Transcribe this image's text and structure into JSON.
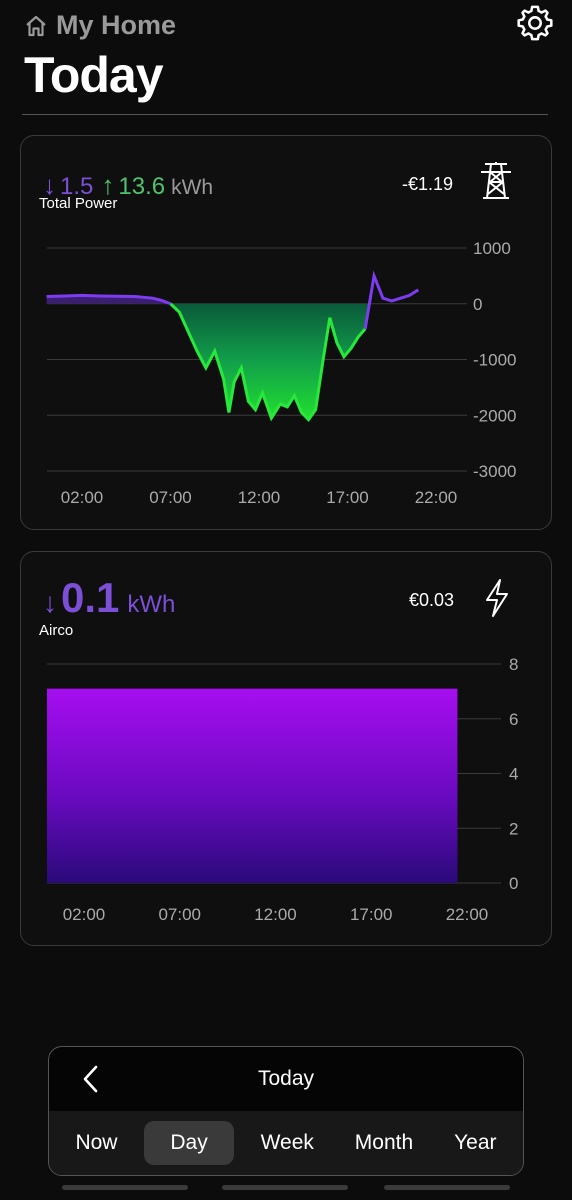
{
  "header": {
    "home_label": "My Home",
    "title": "Today"
  },
  "power_card": {
    "down_arrow": "↓",
    "down_value": "1.5",
    "up_arrow": "↑",
    "up_value": "13.6",
    "unit": "kWh",
    "label": "Total Power",
    "cost": "-€1.19",
    "icon": "power-pylon-icon"
  },
  "airco_card": {
    "down_arrow": "↓",
    "value": "0.1",
    "unit": "kWh",
    "label": "Airco",
    "cost": "€0.03",
    "icon": "lightning-icon"
  },
  "nav": {
    "title": "Today",
    "tabs": [
      {
        "label": "Now",
        "active": false
      },
      {
        "label": "Day",
        "active": true
      },
      {
        "label": "Week",
        "active": false
      },
      {
        "label": "Month",
        "active": false
      },
      {
        "label": "Year",
        "active": false
      }
    ]
  },
  "colors": {
    "purple": "#7b4fd6",
    "green": "#4fc36c",
    "bar": "#a010e8",
    "line_green": "#28e83a"
  },
  "chart_data": [
    {
      "type": "area",
      "x_ticks": [
        "02:00",
        "07:00",
        "12:00",
        "17:00",
        "22:00"
      ],
      "y_ticks": [
        1000,
        0,
        -1000,
        -2000,
        -3000
      ],
      "ylim": [
        -3000,
        1000
      ],
      "x_unit": "hour",
      "x": [
        0,
        1,
        2,
        3,
        4,
        5,
        6,
        6.5,
        7,
        7.5,
        8,
        8.5,
        9,
        9.5,
        10,
        10.3,
        10.6,
        11,
        11.4,
        11.8,
        12.2,
        12.7,
        13.2,
        13.6,
        14,
        14.4,
        14.8,
        15.2,
        15.6,
        16,
        16.4,
        16.8,
        17.2,
        17.6,
        18,
        18.5,
        19,
        19.5,
        20,
        20.5,
        21
      ],
      "values": [
        130,
        140,
        150,
        140,
        135,
        130,
        100,
        60,
        0,
        -150,
        -500,
        -850,
        -1150,
        -850,
        -1350,
        -1950,
        -1400,
        -1150,
        -1750,
        -1900,
        -1600,
        -2050,
        -1800,
        -1850,
        -1650,
        -1950,
        -2080,
        -1900,
        -1050,
        -250,
        -700,
        -950,
        -800,
        -600,
        -450,
        500,
        100,
        50,
        100,
        150,
        250
      ],
      "grid": true
    },
    {
      "type": "bar",
      "x_ticks": [
        "02:00",
        "07:00",
        "12:00",
        "17:00",
        "22:00"
      ],
      "y_ticks": [
        8,
        6,
        4,
        2,
        0
      ],
      "ylim": [
        0,
        8
      ],
      "bar": {
        "x_start": 0,
        "x_end": 21.5,
        "value": 7.1
      },
      "grid": true
    }
  ]
}
